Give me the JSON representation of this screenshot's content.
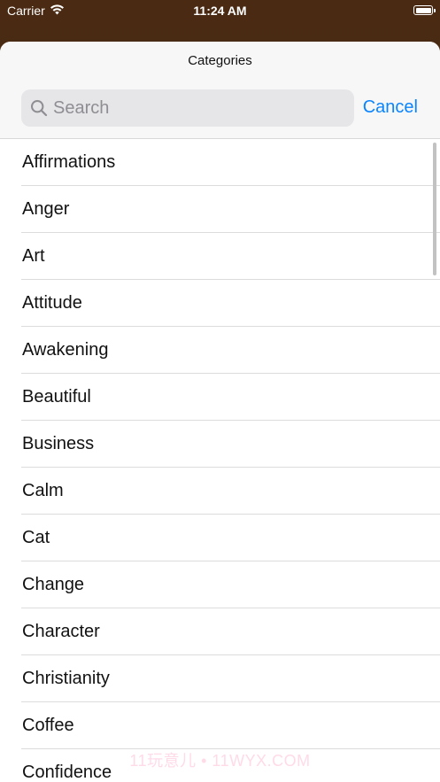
{
  "status_bar": {
    "carrier": "Carrier",
    "time": "11:24 AM",
    "wifi_icon": "wifi-icon",
    "battery_icon": "battery-icon"
  },
  "sheet": {
    "title": "Categories",
    "search": {
      "placeholder": "Search",
      "value": "",
      "icon": "search-icon"
    },
    "cancel_label": "Cancel"
  },
  "categories": [
    "Affirmations",
    "Anger",
    "Art",
    "Attitude",
    "Awakening",
    "Beautiful",
    "Business",
    "Calm",
    "Cat",
    "Change",
    "Character",
    "Christianity",
    "Coffee",
    "Confidence"
  ],
  "watermark": "11玩意儿 • 11WYX.COM",
  "colors": {
    "accent": "#0a84ff",
    "background_behind_sheet": "#4a2a12",
    "search_field": "#e6e6e9",
    "separator": "#dcdcdc"
  }
}
